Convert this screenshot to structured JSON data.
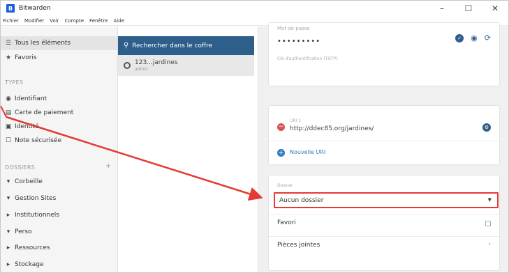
{
  "app": {
    "icon_letter": "B",
    "title": "Bitwarden"
  },
  "window_controls": {
    "minimize": "–",
    "maximize": "☐",
    "close": "✕"
  },
  "menubar": [
    "Fichier",
    "Modifier",
    "Voir",
    "Compte",
    "Fenêtre",
    "Aide"
  ],
  "sidebar": {
    "all_items": "Tous les éléments",
    "favorites": "Favoris",
    "types_header": "TYPES",
    "types": [
      "Identifiant",
      "Carte de paiement",
      "Identité",
      "Note sécurisée"
    ],
    "folders_header": "DOSSIERS",
    "folders_add": "+",
    "folders": [
      {
        "label": "Corbeille",
        "toggle": "▾"
      },
      {
        "label": "Gestion Sites",
        "toggle": "▾"
      },
      {
        "label": "Institutionnels",
        "toggle": "▸"
      },
      {
        "label": "Perso",
        "toggle": "▾"
      },
      {
        "label": "Ressources",
        "toggle": "▸"
      },
      {
        "label": "Stockage",
        "toggle": "▸"
      }
    ],
    "icons": {
      "all_items": "list-icon",
      "favorites": "star-icon",
      "login": "globe-icon",
      "card": "credit-card-icon",
      "identity": "id-card-icon",
      "note": "note-icon"
    }
  },
  "list": {
    "search_placeholder": "Rechercher dans le coffre",
    "items": [
      {
        "title": "123...jardines",
        "subtitle": "admin"
      }
    ]
  },
  "detail": {
    "password": {
      "label": "Mot de passe",
      "value": "•••••••••"
    },
    "totp_label": "Clé d'authentification (TOTP)",
    "uri": {
      "label": "URI 1",
      "value": "http://ddec85.org/jardines/"
    },
    "new_uri": "Nouvelle URI",
    "folder": {
      "label": "Dossier",
      "value": "Aucun dossier"
    },
    "favorite_label": "Favori",
    "attachments_label": "Pièces jointes"
  },
  "annotation": {
    "arrow_color": "#e53935",
    "highlight_color": "#e53935"
  }
}
